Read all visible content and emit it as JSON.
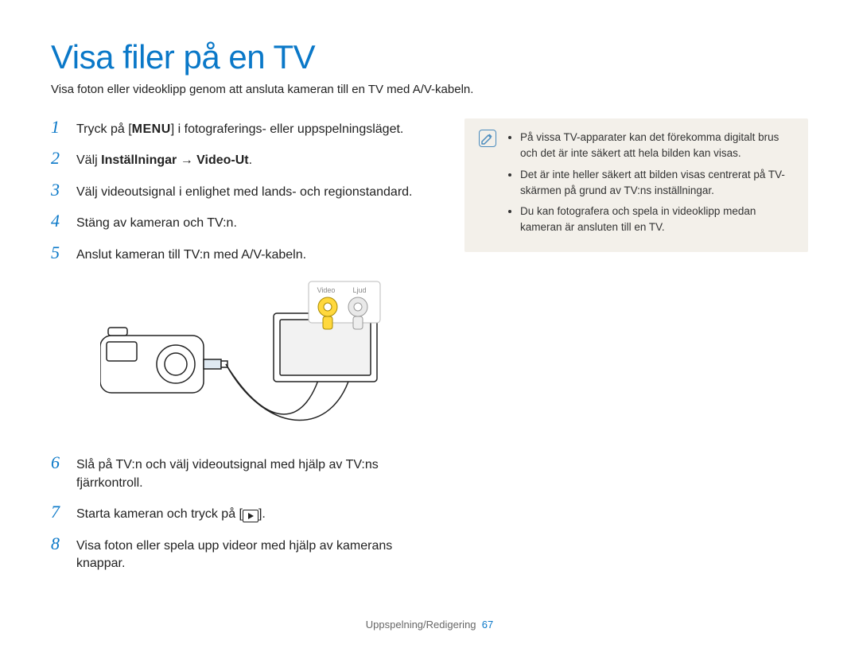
{
  "title": "Visa filer på en TV",
  "subtitle": "Visa foton eller videoklipp genom att ansluta kameran till en TV med A/V-kabeln.",
  "steps": {
    "s1_pre": "Tryck på [",
    "s1_key": "MENU",
    "s1_post": "] i fotograferings- eller uppspelningsläget.",
    "s2_pre": "Välj ",
    "s2_bold": "Inställningar → Video-Ut",
    "s2_post": ".",
    "s3": "Välj videoutsignal i enlighet med lands- och regionstandard.",
    "s4": "Stäng av kameran och TV:n.",
    "s5": "Anslut kameran till TV:n med A/V-kabeln.",
    "s6": "Slå på TV:n och välj videoutsignal med hjälp av TV:ns fjärrkontroll.",
    "s7_pre": "Starta kameran och tryck på [",
    "s7_post": "].",
    "s8": "Visa foton eller spela upp videor med hjälp av kamerans knappar."
  },
  "step_numbers": {
    "n1": "1",
    "n2": "2",
    "n3": "3",
    "n4": "4",
    "n5": "5",
    "n6": "6",
    "n7": "7",
    "n8": "8"
  },
  "diagram": {
    "video_label": "Video",
    "audio_label": "Ljud"
  },
  "notes": {
    "i1": "På vissa TV-apparater kan det förekomma digitalt brus och det är inte säkert att hela bilden kan visas.",
    "i2": "Det är inte heller säkert att bilden visas centrerat på TV-skärmen på grund av TV:ns inställningar.",
    "i3": "Du kan fotografera och spela in videoklipp medan kameran är ansluten till en TV."
  },
  "footer": {
    "section": "Uppspelning/Redigering",
    "page": "67"
  }
}
